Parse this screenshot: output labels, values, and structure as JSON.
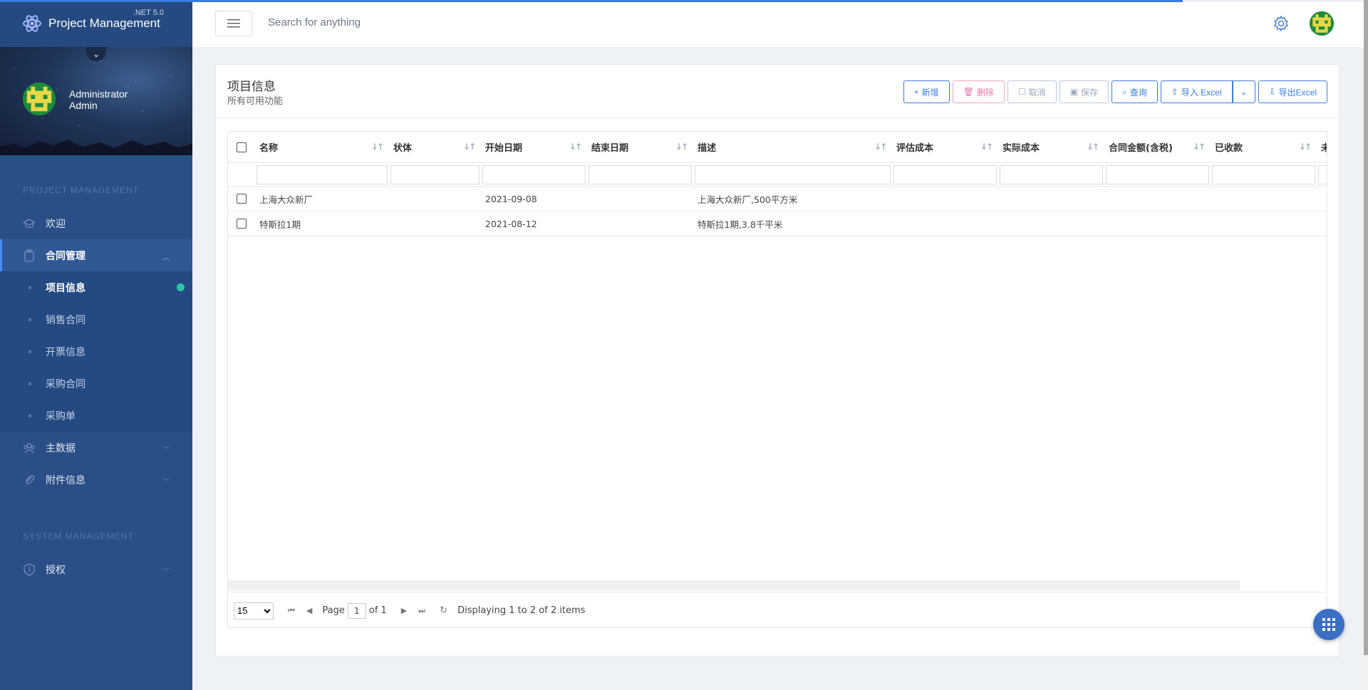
{
  "app": {
    "title": "Project Management",
    "version": ".NET 5.0"
  },
  "user": {
    "name": "Administrator",
    "role": "Admin"
  },
  "sidebar": {
    "section_project": "PROJECT MANAGEMENT",
    "items": [
      {
        "label": "欢迎",
        "icon": "graduation-cap-icon"
      },
      {
        "label": "合同管理",
        "icon": "clipboard-icon",
        "active": true,
        "children": [
          {
            "label": "项目信息",
            "active": true
          },
          {
            "label": "销售合同"
          },
          {
            "label": "开票信息"
          },
          {
            "label": "采购合同"
          },
          {
            "label": "采购单"
          }
        ]
      },
      {
        "label": "主数据",
        "icon": "users-icon"
      },
      {
        "label": "附件信息",
        "icon": "paperclip-icon"
      }
    ],
    "section_system": "SYSTEM MANAGEMENT",
    "system_items": [
      {
        "label": "授权",
        "icon": "shield-icon"
      }
    ]
  },
  "header": {
    "search_placeholder": "Search for anything"
  },
  "page": {
    "title": "项目信息",
    "subtitle": "所有可用功能"
  },
  "toolbar": {
    "add": "新增",
    "delete": "删除",
    "cancel": "取消",
    "save": "保存",
    "query": "查询",
    "import_excel": "导入 Excel",
    "export_excel": "导出Excel"
  },
  "grid": {
    "columns": [
      "名称",
      "状体",
      "开始日期",
      "结束日期",
      "描述",
      "评估成本",
      "实际成本",
      "合同金额(含税)",
      "已收款",
      "未"
    ],
    "rows": [
      {
        "name": "上海大众新厂",
        "status": "",
        "start": "2021-09-08",
        "end": "",
        "desc": "上海大众新厂,500平方米"
      },
      {
        "name": "特斯拉1期",
        "status": "",
        "start": "2021-08-12",
        "end": "",
        "desc": "特斯拉1期,3.8千平米"
      }
    ]
  },
  "pager": {
    "page_size": "15",
    "page_label": "Page",
    "page_value": "1",
    "of_label": "of 1",
    "display_text": "Displaying 1 to 2 of 2 items"
  },
  "colors": {
    "accent": "#3b7ddd",
    "sidebar": "#2a4f86",
    "status_dot": "#28c6a0"
  }
}
